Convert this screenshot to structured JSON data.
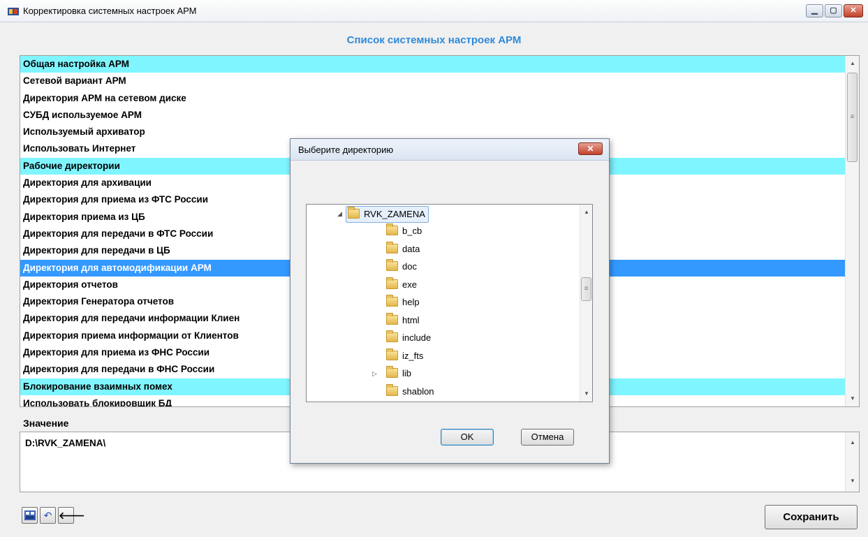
{
  "window": {
    "title": "Корректировка системных настроек АРМ",
    "heading": "Список системных настроек АРМ",
    "controls": {
      "minimize": "▁",
      "maximize": "▢",
      "close": "✕"
    }
  },
  "settings": {
    "rows": [
      {
        "label": "Общая настройка АРМ",
        "kind": "group"
      },
      {
        "label": "Сетевой вариант АРМ",
        "kind": "item"
      },
      {
        "label": "Директория АРМ на сетевом диске",
        "kind": "item"
      },
      {
        "label": "СУБД используемое АРМ",
        "kind": "item"
      },
      {
        "label": "Используемый архиватор",
        "kind": "item"
      },
      {
        "label": "Использовать Интернет",
        "kind": "item"
      },
      {
        "label": "Рабочие директории",
        "kind": "group"
      },
      {
        "label": "Директория для архивации",
        "kind": "item"
      },
      {
        "label": "Директория для приема из ФТС России",
        "kind": "item"
      },
      {
        "label": "Директория приема из ЦБ",
        "kind": "item"
      },
      {
        "label": "Директория для передачи в ФТС России",
        "kind": "item"
      },
      {
        "label": "Директория для передачи в ЦБ",
        "kind": "item"
      },
      {
        "label": "Директория для автомодификации АРМ",
        "kind": "selected"
      },
      {
        "label": "Директория отчетов",
        "kind": "item"
      },
      {
        "label": "Директория Генератора отчетов",
        "kind": "item"
      },
      {
        "label": "Директория для передачи информации Клиен",
        "kind": "item"
      },
      {
        "label": "Директория приема информации от Клиентов",
        "kind": "item"
      },
      {
        "label": "Директория для приема из ФНС России",
        "kind": "item"
      },
      {
        "label": "Директория для передачи в ФНС России",
        "kind": "item"
      },
      {
        "label": "Блокирование взаимных помех",
        "kind": "group"
      },
      {
        "label": "Использовать блокировщик БД",
        "kind": "item"
      }
    ],
    "scroll_position": 0.0
  },
  "value": {
    "label": "Значение",
    "text": "D:\\RVK_ZAMENA\\"
  },
  "toolbar": {
    "undo_glyph": "↶",
    "back_glyph": "🡐",
    "save_label": "Сохранить"
  },
  "dialog": {
    "title": "Выберите директорию",
    "close_glyph": "✕",
    "root_folder": "RVK_ZAMENA",
    "folders": [
      {
        "name": "b_cb",
        "expandable": false
      },
      {
        "name": "data",
        "expandable": false
      },
      {
        "name": "doc",
        "expandable": false
      },
      {
        "name": "exe",
        "expandable": false
      },
      {
        "name": "help",
        "expandable": false
      },
      {
        "name": "html",
        "expandable": false
      },
      {
        "name": "include",
        "expandable": false
      },
      {
        "name": "iz_fts",
        "expandable": false
      },
      {
        "name": "lib",
        "expandable": true
      },
      {
        "name": "shablon",
        "expandable": false
      }
    ],
    "ok_label": "OK",
    "cancel_label": "Отмена"
  },
  "colors": {
    "group_row": "#7ff5ff",
    "selected_row": "#3399ff",
    "heading": "#2e8ad8"
  }
}
